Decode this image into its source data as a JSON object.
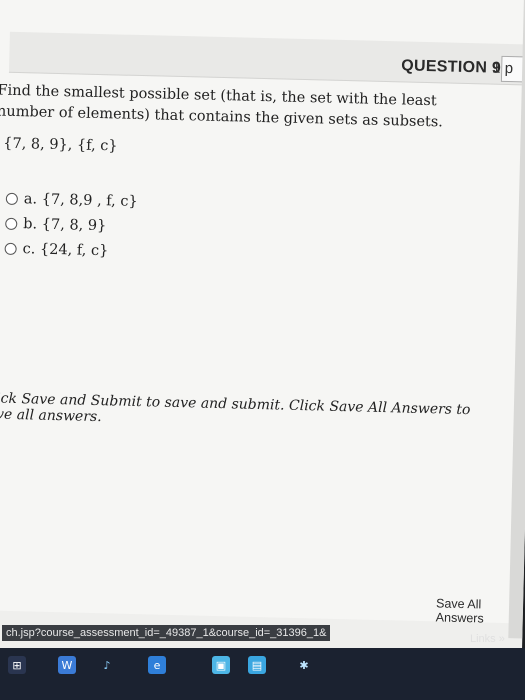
{
  "question": {
    "title": "QUESTION 9",
    "points": "1 p",
    "prompt": "Find the smallest possible set (that is, the set with the least number of elements) that contains the given sets as subsets.",
    "given_sets": "{7, 8, 9}, {f, c}",
    "choices": [
      {
        "label": "a. {7, 8,9 , f, c}"
      },
      {
        "label": "b. {7, 8, 9}"
      },
      {
        "label": "c. {24, f, c}"
      }
    ],
    "instruction": "Click Save and Submit to save and submit. Click Save All Answers to save all answers.",
    "save_all_label": "Save All Answers"
  },
  "browser": {
    "status_url": "ch.jsp?course_assessment_id=_49387_1&course_id=_31396_1&",
    "links_label": "Links",
    "chevron": "»"
  },
  "taskbar": {
    "icons": [
      "windows-icon",
      "word-icon",
      "audio-icon",
      "explorer-icon",
      "photos-icon",
      "store-icon",
      "settings-icon"
    ]
  }
}
